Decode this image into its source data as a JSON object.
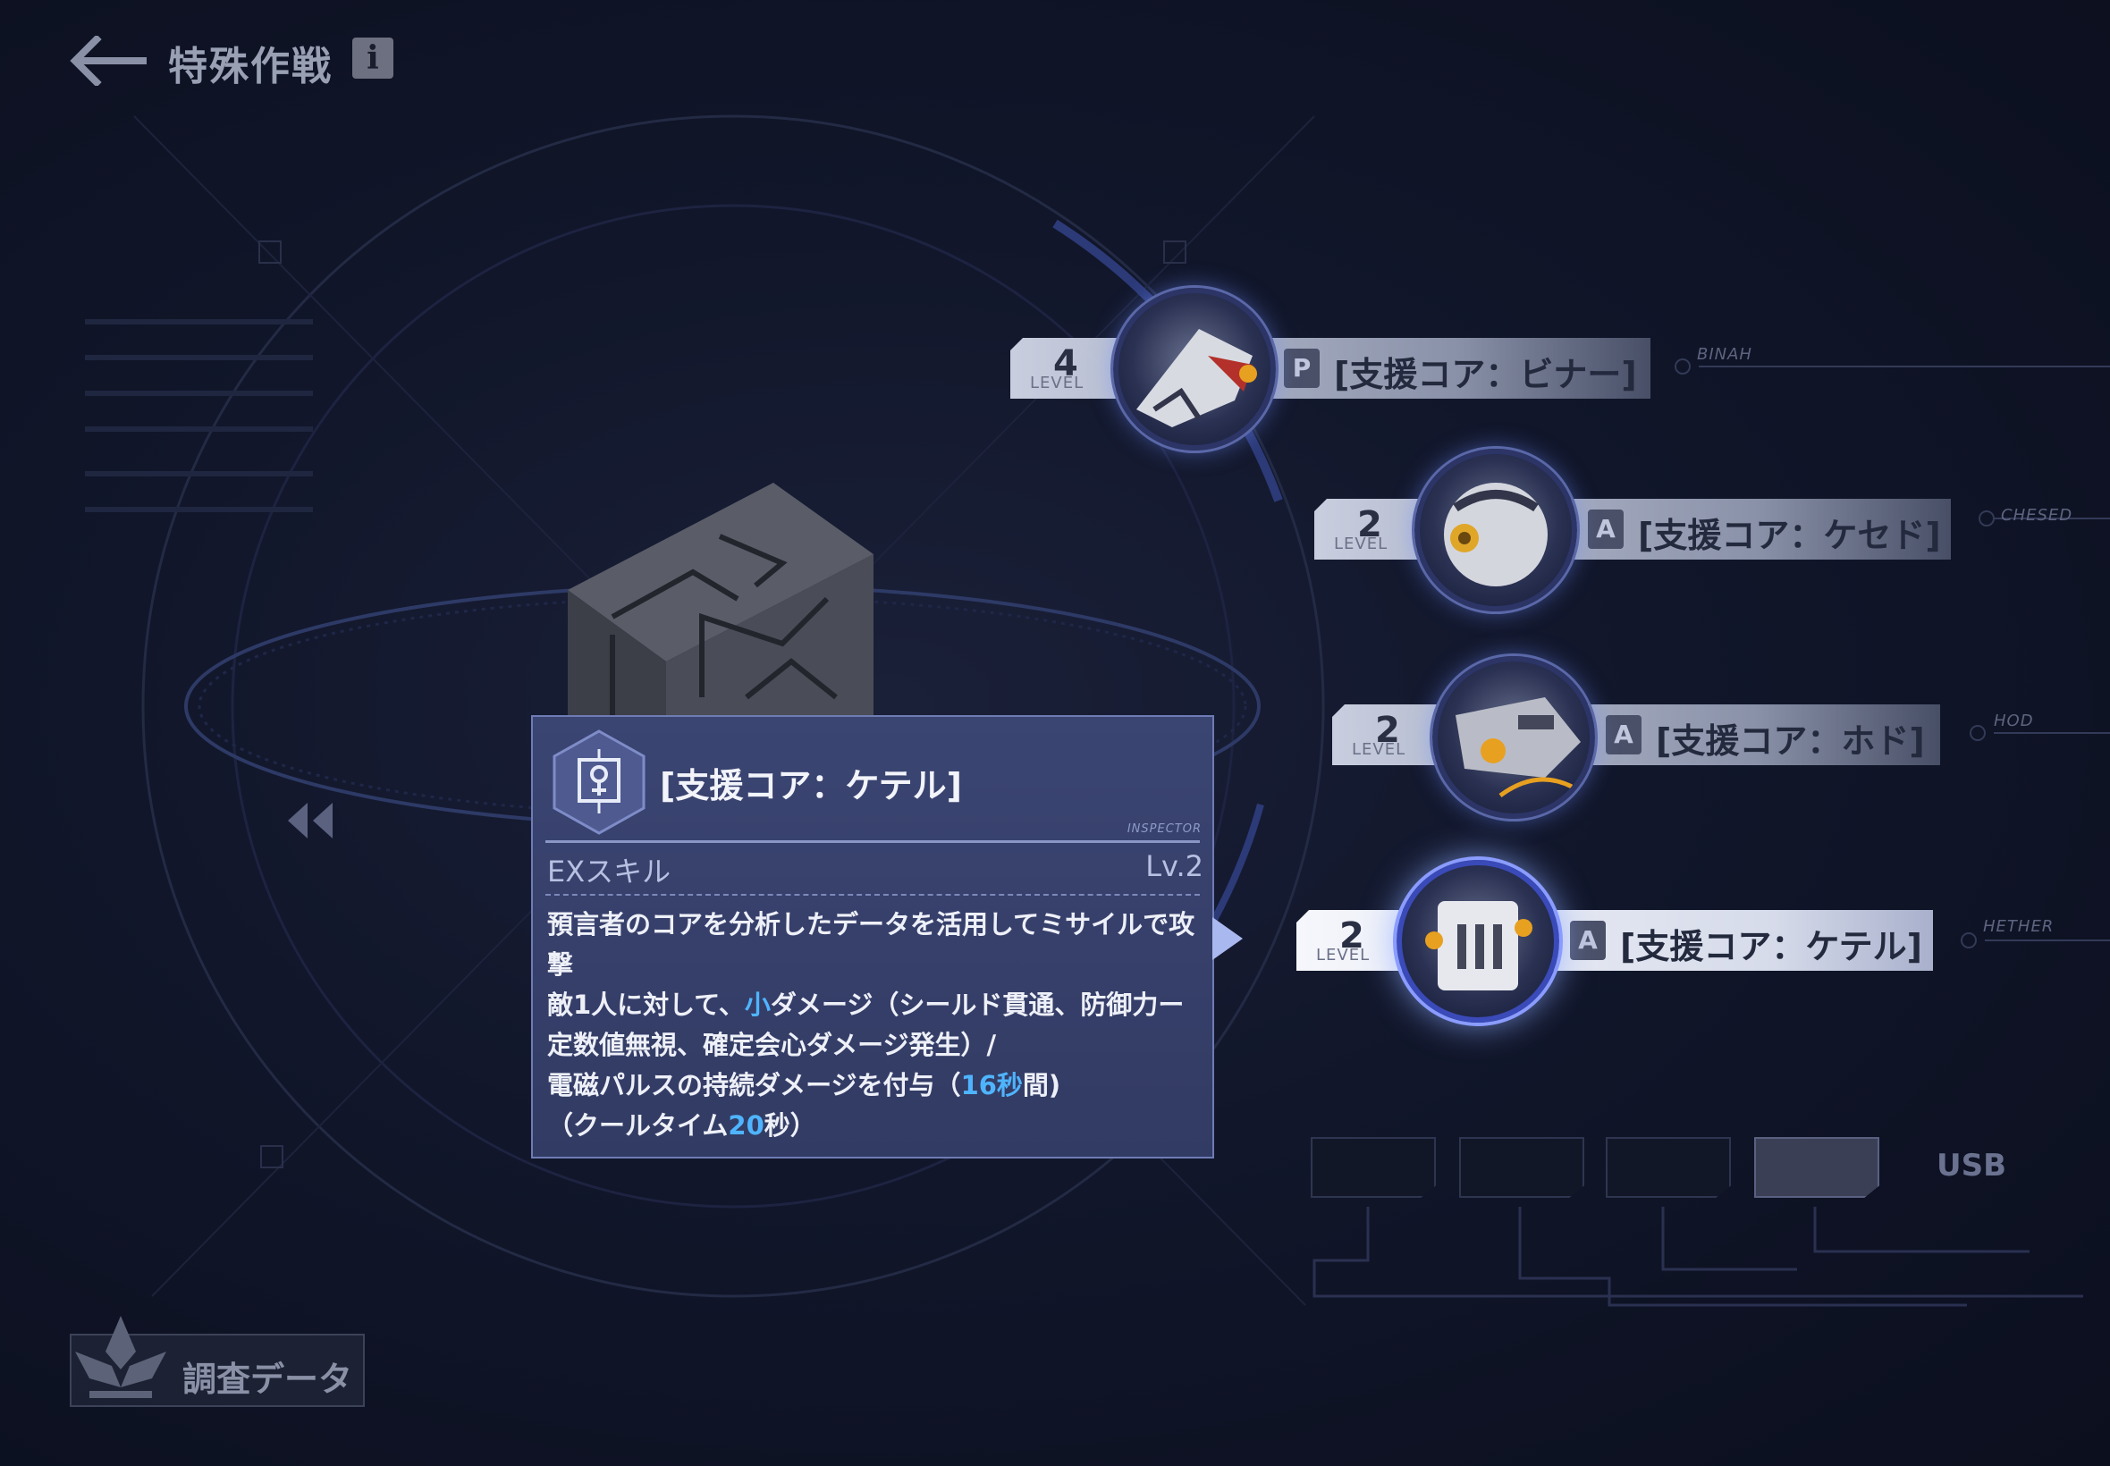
{
  "header": {
    "title": "特殊作戦",
    "info_label": "i"
  },
  "skill_panel": {
    "title": "[支援コア：ケテル]",
    "tag": "INSPECTOR",
    "skill_type": "EXスキル",
    "skill_level": "Lv.2",
    "desc": {
      "l1": "預言者のコアを分析したデータを活用してミサイルで攻",
      "l2": "撃",
      "l3a": "敵1人に対して、",
      "l3b": "小",
      "l3c": "ダメージ（シールド貫通、防御力ー",
      "l4": "定数値無視、確定会心ダメージ発生）/",
      "l5a": "電磁パルスの持続ダメージを付与（",
      "l5b": "16秒",
      "l5c": "間)",
      "l6a": "（クールタイム",
      "l6b": "20",
      "l6c": "秒）"
    }
  },
  "cores": [
    {
      "level": "4",
      "level_label": "LEVEL",
      "tag_icon": "P",
      "name": "[支援コア：ビナー]",
      "side_label": "BINAH"
    },
    {
      "level": "2",
      "level_label": "LEVEL",
      "tag_icon": "A",
      "name": "[支援コア：ケセド]",
      "side_label": "CHESED"
    },
    {
      "level": "2",
      "level_label": "LEVEL",
      "tag_icon": "A",
      "name": "[支援コア：ホド]",
      "side_label": "HOD"
    },
    {
      "level": "2",
      "level_label": "LEVEL",
      "tag_icon": "A",
      "name": "[支援コア：ケテル]",
      "side_label": "HETHER",
      "selected": true
    }
  ],
  "slots": {
    "usb_label": "USB"
  },
  "footer": {
    "investigation_label": "調査データ"
  },
  "colors": {
    "highlight": "#4fb4ff",
    "panel_bg": "#3b4572",
    "background": "#11162a"
  },
  "icons": [
    "back-arrow-icon",
    "info-icon",
    "nav-prev-icon",
    "inspector-icon",
    "investigation-icon"
  ]
}
